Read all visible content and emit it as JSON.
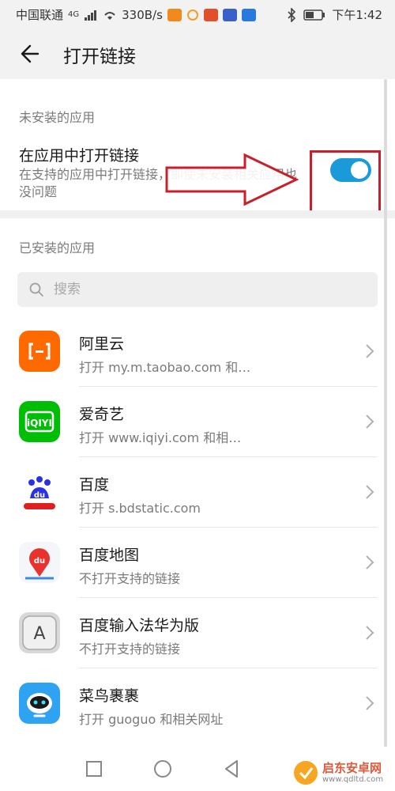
{
  "status_bar": {
    "carrier": "中国联通",
    "network": "4G",
    "speed": "330B/s",
    "time": "下午1:42"
  },
  "app_bar": {
    "title": "打开链接",
    "back_icon": "back-arrow-icon"
  },
  "uninstalled_section": {
    "label": "未安装的应用",
    "toggle_title": "在应用中打开链接",
    "toggle_desc": "在支持的应用中打开链接，即使未安装相关应用也没问题",
    "toggle_on": true,
    "accent_color": "#1a9ad9"
  },
  "installed_section": {
    "label": "已安装的应用",
    "search_placeholder": "搜索"
  },
  "apps": [
    {
      "name": "阿里云",
      "desc": "打开 my.m.taobao.com 和…",
      "icon": "aliyun-icon"
    },
    {
      "name": "爱奇艺",
      "desc": "打开 www.iqiyi.com 和相…",
      "icon": "iqiyi-icon"
    },
    {
      "name": "百度",
      "desc": "打开 s.bdstatic.com",
      "icon": "baidu-icon"
    },
    {
      "name": "百度地图",
      "desc": "不打开支持的链接",
      "icon": "baidu-map-icon"
    },
    {
      "name": "百度输入法华为版",
      "desc": "不打开支持的链接",
      "icon": "baidu-input-icon"
    },
    {
      "name": "菜鸟裹裹",
      "desc": "打开 guoguo 和相关网址",
      "icon": "cainiao-icon"
    }
  ],
  "watermark": {
    "name": "启东安卓网",
    "url": "www.qdltd.com"
  }
}
